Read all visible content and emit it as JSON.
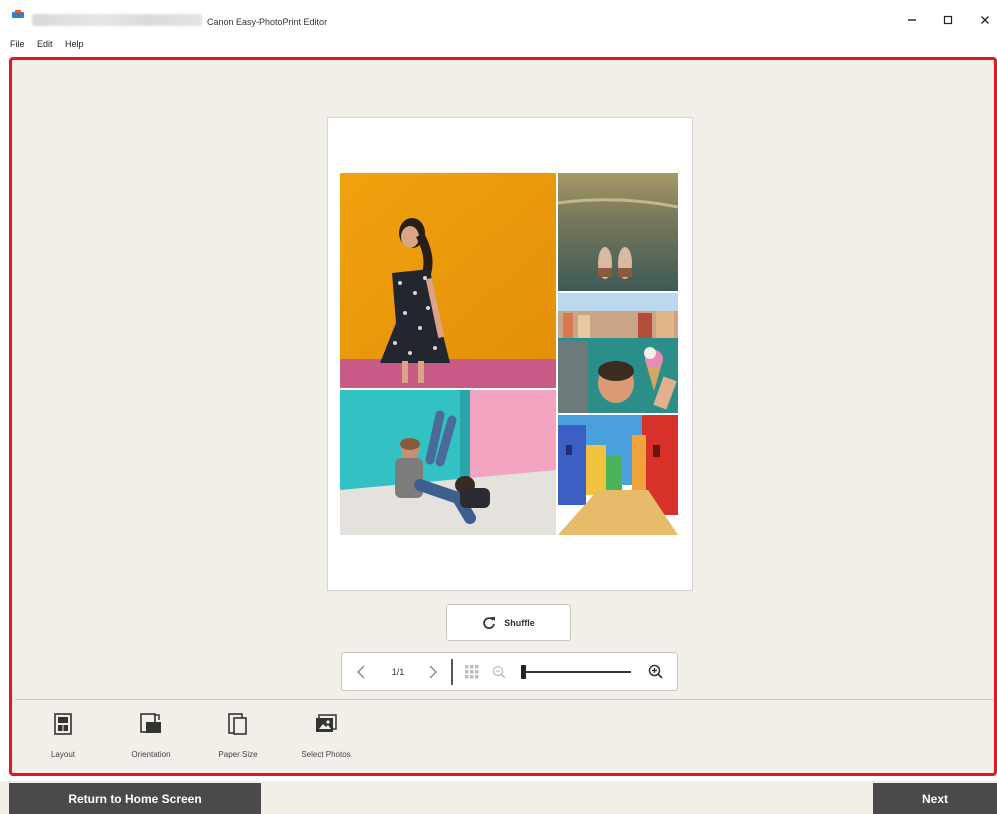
{
  "window": {
    "title": "Canon Easy-PhotoPrint Editor",
    "minimize_icon": "minimize-icon",
    "maximize_icon": "maximize-icon",
    "close_icon": "close-icon"
  },
  "menu": {
    "items": [
      {
        "label": "File"
      },
      {
        "label": "Edit"
      },
      {
        "label": "Help"
      }
    ]
  },
  "preview": {
    "photos": [
      {
        "name": "photo-woman-yellow-wall"
      },
      {
        "name": "photo-feet-pavement"
      },
      {
        "name": "photo-venice-ice-cream"
      },
      {
        "name": "photo-couple-turquoise-room"
      },
      {
        "name": "photo-colorful-houses"
      }
    ]
  },
  "shuffle": {
    "label": "Shuffle",
    "icon": "refresh-icon"
  },
  "pager": {
    "page_indicator": "1/1",
    "icons": [
      "chevron-left-icon",
      "chevron-right-icon",
      "grid-icon",
      "zoom-out-icon",
      "zoom-in-icon"
    ],
    "zoom_level": 0.0
  },
  "tools": [
    {
      "label": "Layout",
      "icon": "layout-icon"
    },
    {
      "label": "Orientation",
      "icon": "orientation-icon"
    },
    {
      "label": "Paper Size",
      "icon": "paper-size-icon"
    },
    {
      "label": "Select Photos",
      "icon": "select-photos-icon"
    }
  ],
  "footer": {
    "home_label": "Return to Home Screen",
    "next_label": "Next"
  },
  "colors": {
    "accent_outline": "#e8141e",
    "workspace_bg": "#f2efe9",
    "footer_button": "#4a4a4a"
  }
}
